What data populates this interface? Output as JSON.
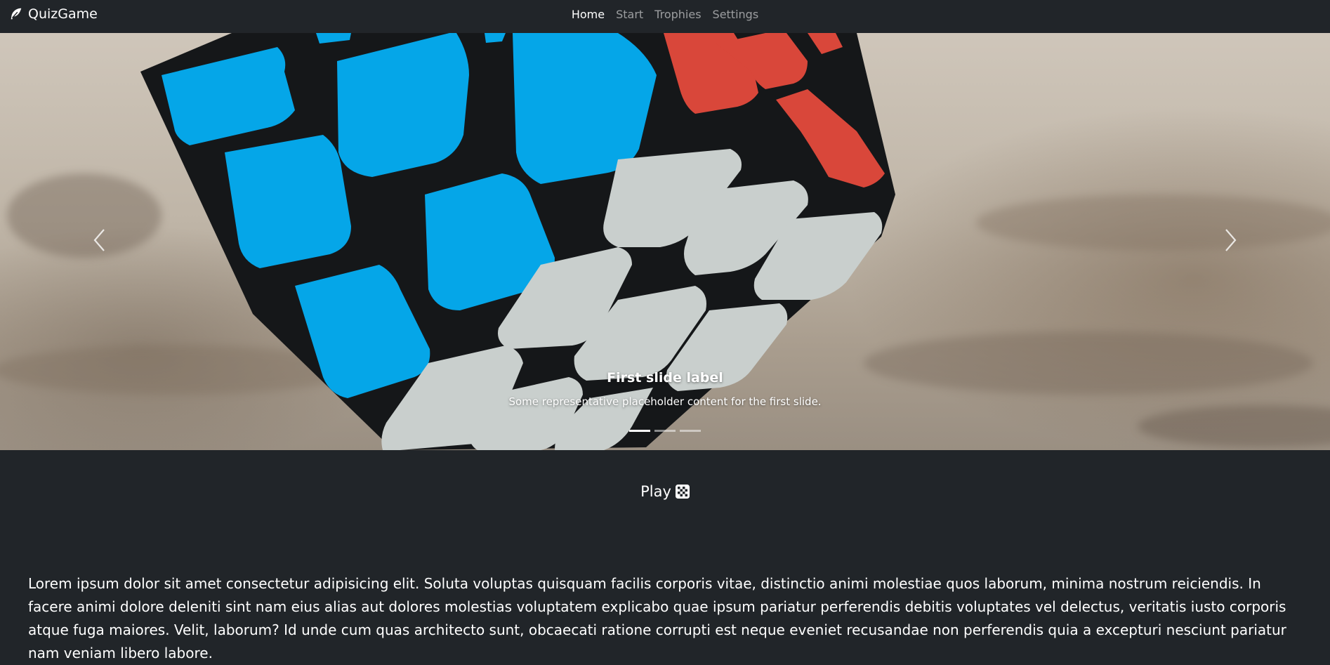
{
  "navbar": {
    "brand": "QuizGame",
    "brand_icon": "feather-icon",
    "links": [
      {
        "label": "Home",
        "active": true
      },
      {
        "label": "Start",
        "active": false
      },
      {
        "label": "Trophies",
        "active": false
      },
      {
        "label": "Settings",
        "active": false
      }
    ]
  },
  "carousel": {
    "slide_image": "rubiks-cube-photo",
    "caption_title": "First slide label",
    "caption_text": "Some representative placeholder content for the first slide.",
    "indicator_count": 3,
    "active_indicator": 1,
    "prev_icon": "chevron-left-icon",
    "next_icon": "chevron-right-icon"
  },
  "play": {
    "label": "Play",
    "icon": "checkerboard-icon"
  },
  "body_text": "Lorem ipsum dolor sit amet consectetur adipisicing elit. Soluta voluptas quisquam facilis corporis vitae, distinctio animi molestiae quos laborum, minima nostrum reiciendis. In facere animi dolore deleniti sint nam eius alias aut dolores molestias voluptatem explicabo quae ipsum pariatur perferendis debitis voluptates vel delectus, veritatis iusto corporis atque fuga maiores. Velit, laborum? Id unde cum quas architecto sunt, obcaecati ratione corrupti est neque eveniet recusandae non perferendis quia a excepturi nesciunt pariatur nam veniam libero labore.",
  "colors": {
    "background": "#212529",
    "cube_blue": "#05a6e8",
    "cube_red": "#d9473a",
    "cube_white": "#c9cfcd",
    "cube_body": "#151719"
  }
}
